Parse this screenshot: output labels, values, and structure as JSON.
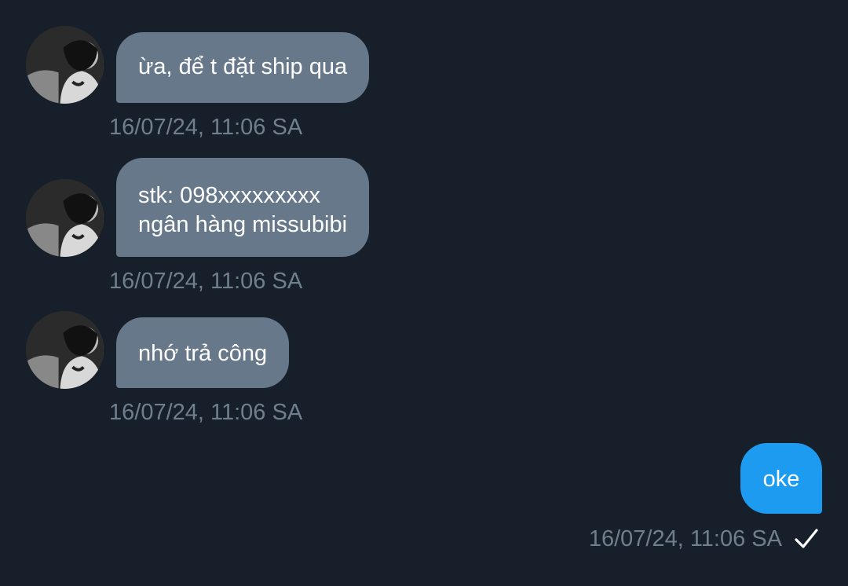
{
  "colors": {
    "background": "#17202a",
    "incoming_bubble": "#66788a",
    "outgoing_bubble": "#1d9bf0",
    "timestamp": "#707f8d",
    "text": "#ffffff"
  },
  "messages": [
    {
      "direction": "incoming",
      "lines": [
        "ừa, để t đặt ship qua"
      ],
      "timestamp": "16/07/24, 11:06 SA",
      "avatar": "user-avatar"
    },
    {
      "direction": "incoming",
      "lines": [
        "stk: 098xxxxxxxxx",
        "ngân hàng missubibi"
      ],
      "timestamp": "16/07/24, 11:06 SA",
      "avatar": "user-avatar"
    },
    {
      "direction": "incoming",
      "lines": [
        "nhớ trả công"
      ],
      "timestamp": "16/07/24, 11:06 SA",
      "avatar": "user-avatar"
    },
    {
      "direction": "outgoing",
      "lines": [
        "oke"
      ],
      "timestamp": "16/07/24, 11:06 SA",
      "status_icon": "check-icon"
    }
  ]
}
